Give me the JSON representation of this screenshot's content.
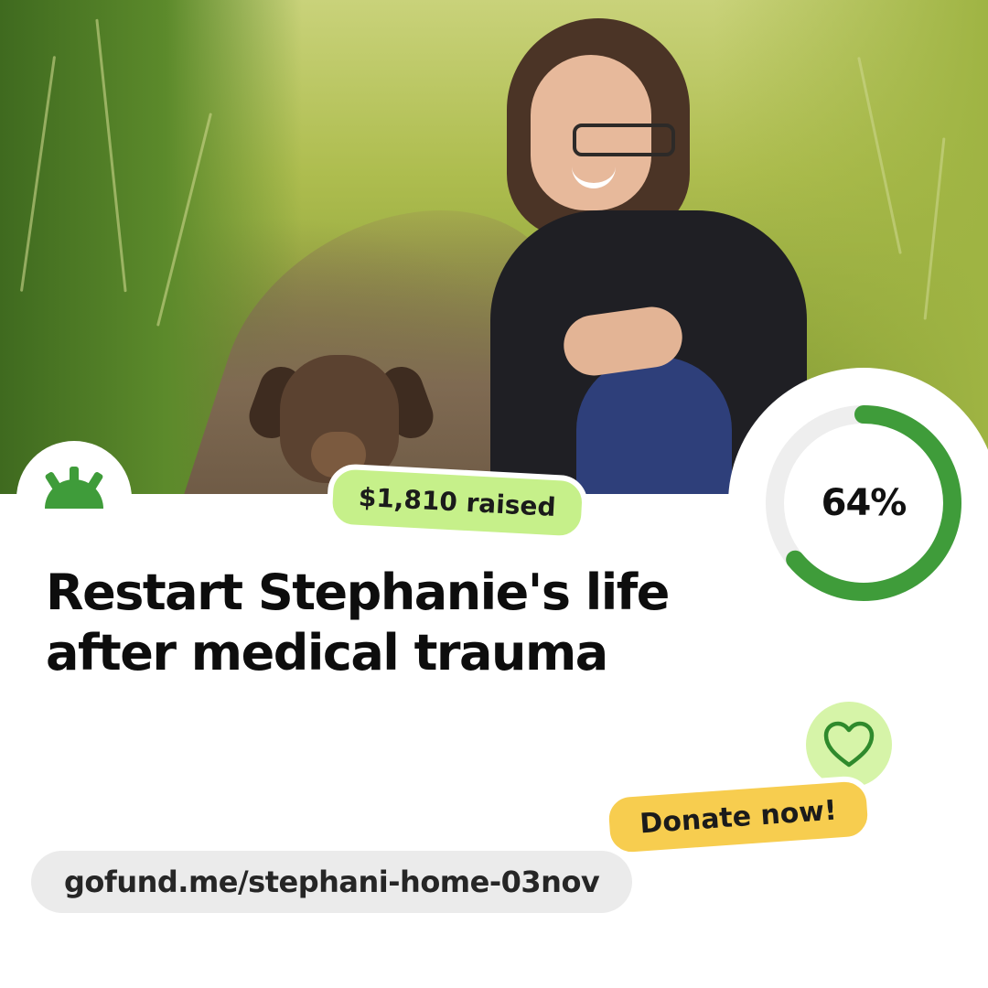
{
  "campaign": {
    "raised_label": "$1,810 raised",
    "progress_percent": 64,
    "progress_label": "64%",
    "title_line1": "Restart Stephanie's life",
    "title_line2": "after medical trauma",
    "donate_label": "Donate now!",
    "url": "gofund.me/stephani-home-03nov"
  },
  "icons": {
    "logo": "gofundme-logo-icon",
    "heart": "heart-icon"
  },
  "colors": {
    "brand_green": "#3f9c3a",
    "progress_track": "#eeeeee",
    "raised_badge": "#c6f08a",
    "donate_badge": "#f7cd4f",
    "heart_bg": "#d6f4a8",
    "url_bg": "#ebebeb"
  }
}
